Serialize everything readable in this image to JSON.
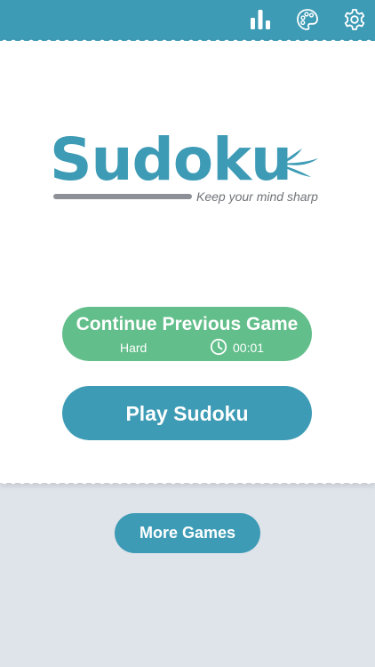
{
  "colors": {
    "brand": "#3d9bb5",
    "continue": "#62be8a",
    "background": "#dfe3ea",
    "card": "#ffffff",
    "underline": "#8d9096",
    "tagline": "#6f7378"
  },
  "topbar": {
    "icons": [
      "stats-icon",
      "palette-icon",
      "settings-icon"
    ]
  },
  "logo": {
    "title": "Sudoku",
    "tagline": "Keep your mind sharp",
    "icon": "leaf-icon"
  },
  "continue_game": {
    "title": "Continue Previous Game",
    "difficulty": "Hard",
    "time": "00:01",
    "icon": "clock-icon"
  },
  "play": {
    "label": "Play Sudoku"
  },
  "more_games": {
    "label": "More Games"
  }
}
